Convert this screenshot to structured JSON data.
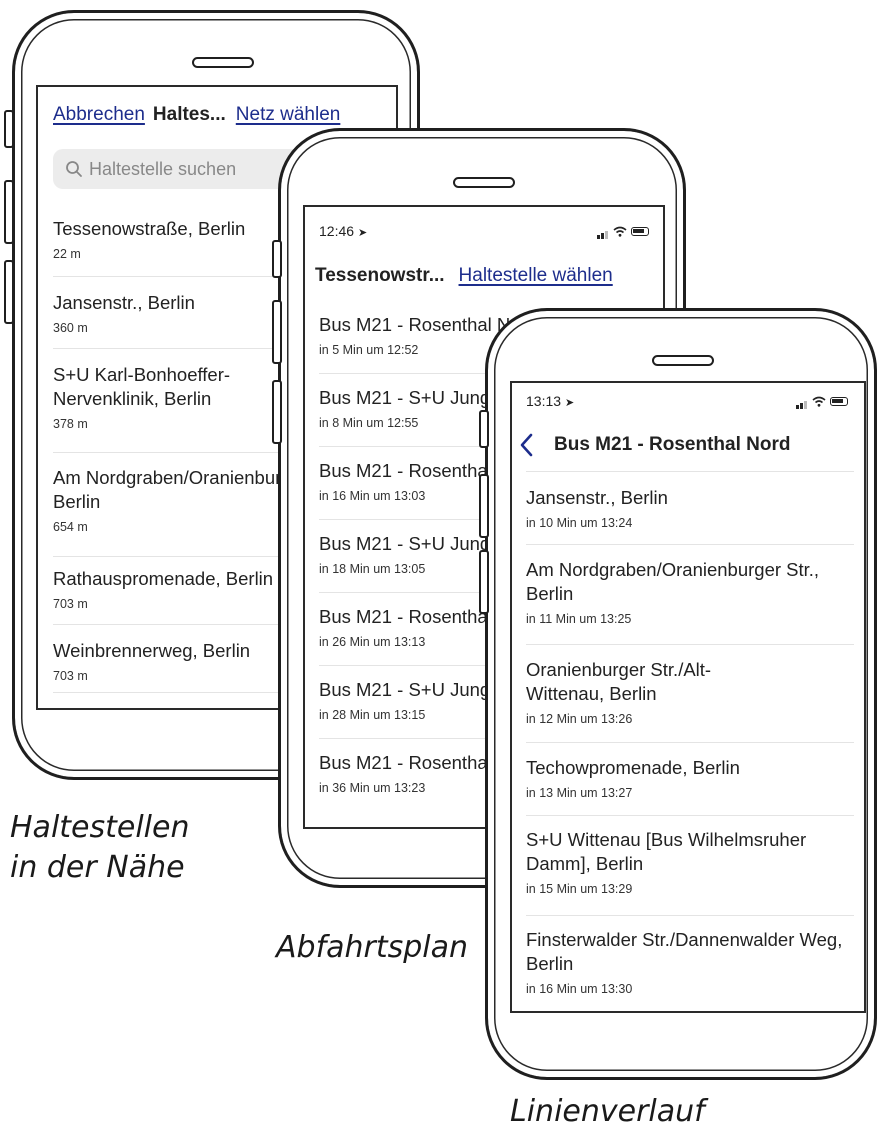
{
  "phone1": {
    "header": {
      "cancel": "Abbrechen",
      "title": "Haltes...",
      "network": "Netz wählen"
    },
    "search": {
      "placeholder": "Haltestelle suchen"
    },
    "stops": [
      {
        "name": "Tessenowstraße, Berlin",
        "distance": "22 m"
      },
      {
        "name": "Jansenstr., Berlin",
        "distance": "360 m"
      },
      {
        "name": "S+U Karl-Bonhoeffer-Nervenklinik, Berlin",
        "distance": "378 m"
      },
      {
        "name": "Am Nordgraben/Oranienburger Str., Berlin",
        "distance": "654 m"
      },
      {
        "name": "Rathauspromenade, Berlin",
        "distance": "703 m"
      },
      {
        "name": "Weinbrennerweg, Berlin",
        "distance": "703 m"
      }
    ],
    "caption": [
      "Haltestellen",
      "in der Nähe"
    ]
  },
  "phone2": {
    "status": {
      "time": "12:46"
    },
    "header": {
      "title": "Tessenowstr...",
      "choose": "Haltestelle wählen"
    },
    "departures": [
      {
        "line": "Bus M21 - Rosenthal Nord",
        "time": "in 5 Min um 12:52"
      },
      {
        "line": "Bus M21 - S+U Jungfernheide",
        "time": "in 8 Min um 12:55"
      },
      {
        "line": "Bus M21 - Rosenthal Nord",
        "time": "in 16 Min um 13:03"
      },
      {
        "line": "Bus M21 - S+U Jungfernheide",
        "time": "in 18 Min um 13:05"
      },
      {
        "line": "Bus M21 - Rosenthal Nord",
        "time": "in 26 Min um 13:13"
      },
      {
        "line": "Bus M21 - S+U Jungfernheide",
        "time": "in 28 Min um 13:15"
      },
      {
        "line": "Bus M21 - Rosenthal Nord",
        "time": "in 36 Min um 13:23"
      }
    ],
    "caption": "Abfahrtsplan"
  },
  "phone3": {
    "status": {
      "time": "13:13"
    },
    "header": {
      "title": "Bus M21 - Rosenthal Nord"
    },
    "stops": [
      {
        "name": "Jansenstr., Berlin",
        "time": "in 10 Min um 13:24"
      },
      {
        "name": "Am Nordgraben/Oranienburger Str., Berlin",
        "time": "in 11 Min um 13:25"
      },
      {
        "name": "Oranienburger Str./Alt-Wittenau, Berlin",
        "time": "in 12 Min um 13:26"
      },
      {
        "name": "Techowpromenade, Berlin",
        "time": "in 13 Min um 13:27"
      },
      {
        "name": "S+U Wittenau [Bus Wilhelmsruher Damm], Berlin",
        "time": "in 15 Min um 13:29"
      },
      {
        "name": "Finsterwalder Str./Dannenwalder Weg, Berlin",
        "time": "in 16 Min um 13:30"
      }
    ],
    "caption": "Linienverlauf"
  }
}
